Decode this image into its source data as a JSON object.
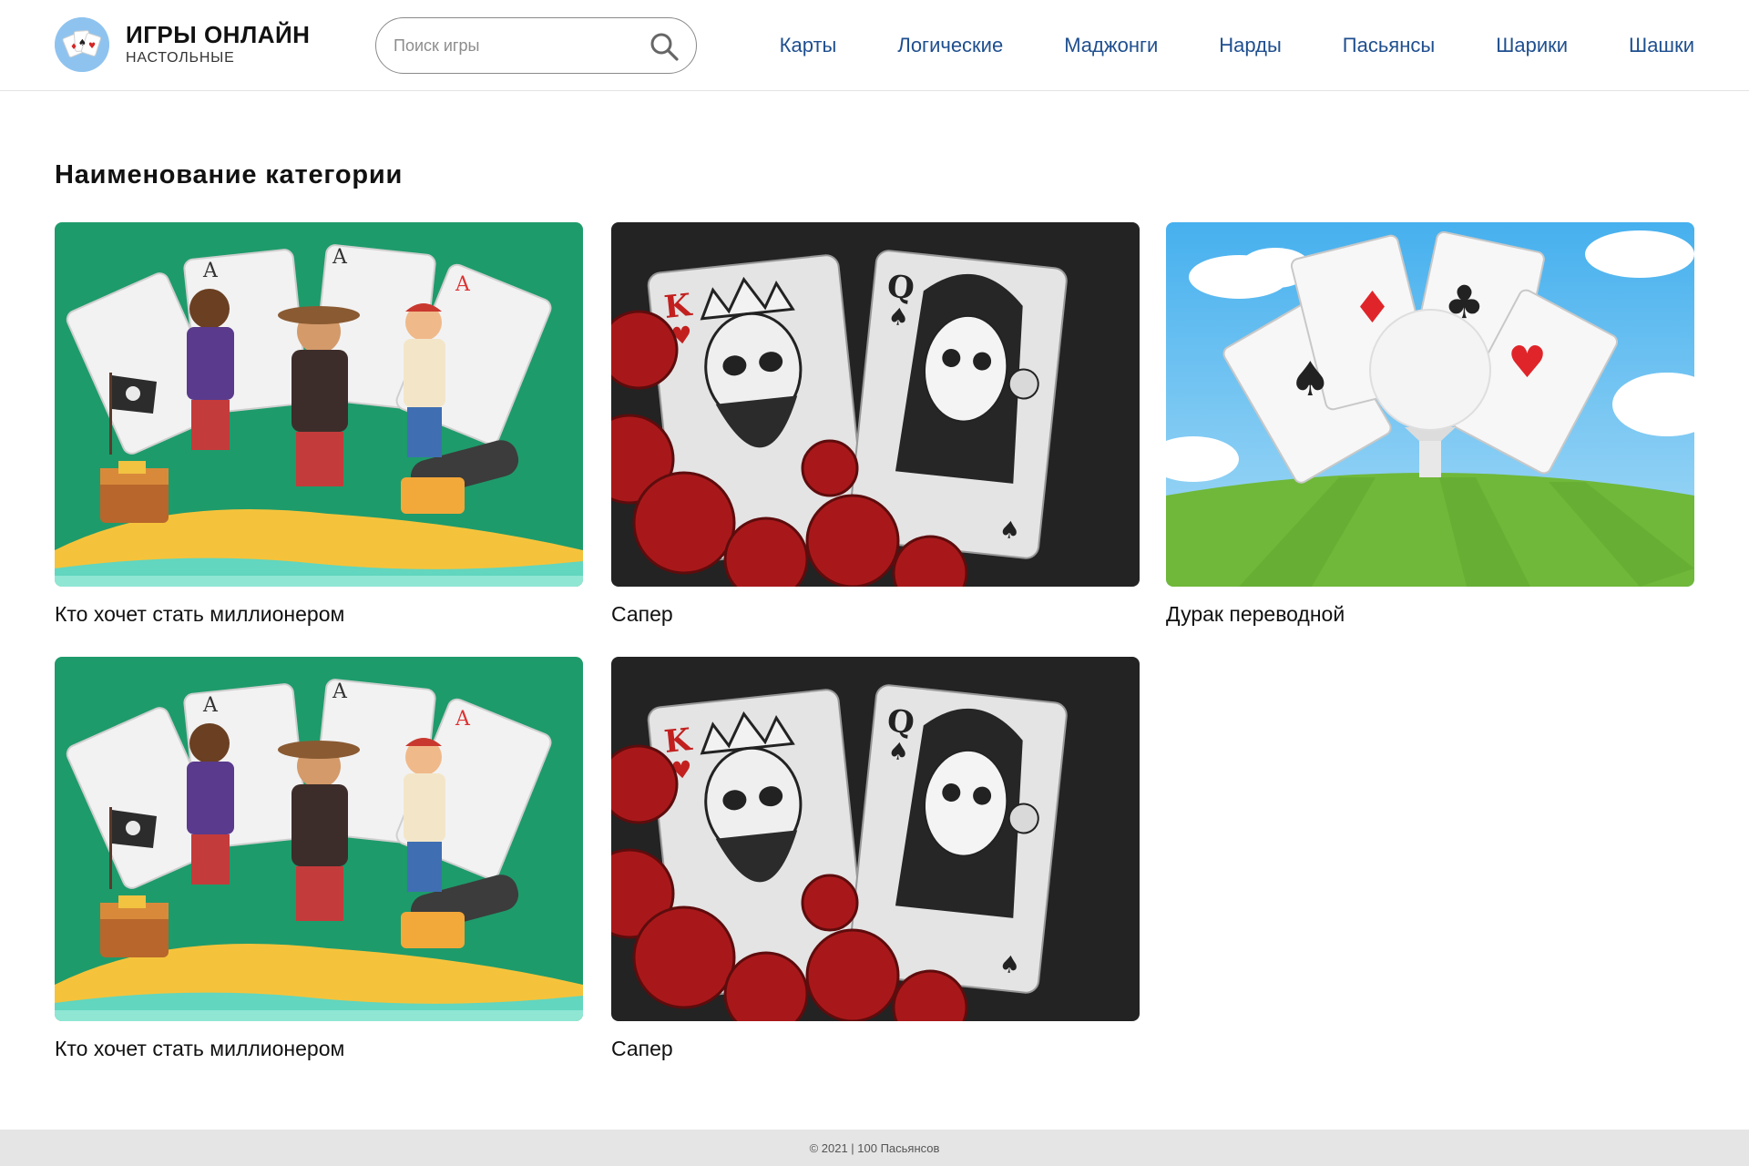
{
  "site": {
    "title": "ИГРЫ ОНЛАЙН",
    "subtitle": "НАСТОЛЬНЫЕ",
    "logo_icon": "playing-cards-logo"
  },
  "search": {
    "placeholder": "Поиск игры",
    "value": "",
    "icon": "search-icon"
  },
  "nav": {
    "items": [
      {
        "label": "Карты"
      },
      {
        "label": "Логические"
      },
      {
        "label": "Маджонги"
      },
      {
        "label": "Нарды"
      },
      {
        "label": "Пасьянсы"
      },
      {
        "label": "Шарики"
      },
      {
        "label": "Шашки"
      }
    ]
  },
  "category": {
    "title": "Наименование категории"
  },
  "games": [
    {
      "title": "Кто хочет стать миллионером",
      "art": "pirates-aces"
    },
    {
      "title": "Сапер",
      "art": "skull-king-queen"
    },
    {
      "title": "Дурак переводной",
      "art": "aces-golf-ball"
    },
    {
      "title": "Кто хочет стать миллионером",
      "art": "pirates-aces"
    },
    {
      "title": "Сапер",
      "art": "skull-king-queen"
    }
  ],
  "footer": {
    "text": "© 2021 | 100 Пасьянсов"
  },
  "colors": {
    "nav_link": "#1f4f8f",
    "footer_bg": "#e5e5e5",
    "pirates_bg": "#1e9b6b",
    "skull_bg": "#232323",
    "golf_sky": "#58b9ee",
    "golf_grass": "#6fb83a"
  }
}
